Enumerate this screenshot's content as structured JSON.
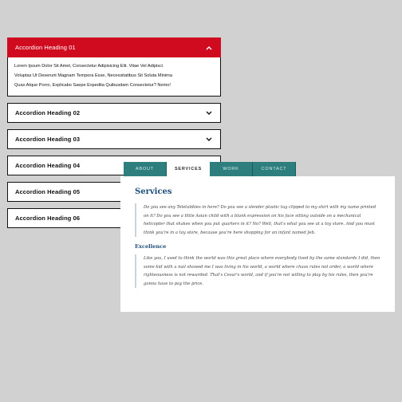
{
  "accordion": {
    "items": [
      {
        "title": "Accordion Heading 01",
        "open": true,
        "body": [
          "Lorem Ipsum Dolor Sit Amet, Consectetur Adipisicing Elit. Vitae Vel Adipisci",
          "Voluptas Ut Deserunt Magnam Tempora Esse, Necessitatibus Sit Soluta Minima",
          "Quas Atque Porro, Explicabo Saepe Expedita Quibusdam Consectetur? Nemo!"
        ],
        "icon": "chevron-up-icon"
      },
      {
        "title": "Accordion Heading 02",
        "icon": "chevron-down-icon"
      },
      {
        "title": "Accordion Heading 03",
        "icon": "chevron-down-icon"
      },
      {
        "title": "Accordion Heading 04",
        "icon": "chevron-down-icon"
      },
      {
        "title": "Accordion Heading 05",
        "icon": "chevron-down-icon"
      },
      {
        "title": "Accordion Heading 06",
        "icon": "chevron-down-icon"
      }
    ],
    "colors": {
      "active_bg": "#d10b1f",
      "border": "#111111"
    }
  },
  "tabs": {
    "labels": [
      "ABOUT",
      "SERVICES",
      "WORK",
      "CONTACT"
    ],
    "active": "SERVICES",
    "colors": {
      "tab_bg": "#2e7e7e",
      "heading": "#1f4f7a"
    },
    "panel": {
      "title": "Services",
      "quote1": "Do you see any Teletubbies in here? Do you see a slender plastic tag clipped to my shirt with my name printed on it? Do you see a little Asian child with a blank expression on his face sitting outside on a mechanical helicopter that shakes when you put quarters in it? No? Well, that's what you see at a toy store. And you must think you're in a toy store, because you're here shopping for an infant named Jeb.",
      "subtitle": "Excellence",
      "quote2": "Like you, I used to think the world was this great place where everybody lived by the same standards I did, then some kid with a nail showed me I was living in his world, a world where chaos rules not order, a world where righteousness is not rewarded. That's Cesar's world, and if you're not willing to play by his rules, then you're gonna have to pay the price."
    }
  }
}
